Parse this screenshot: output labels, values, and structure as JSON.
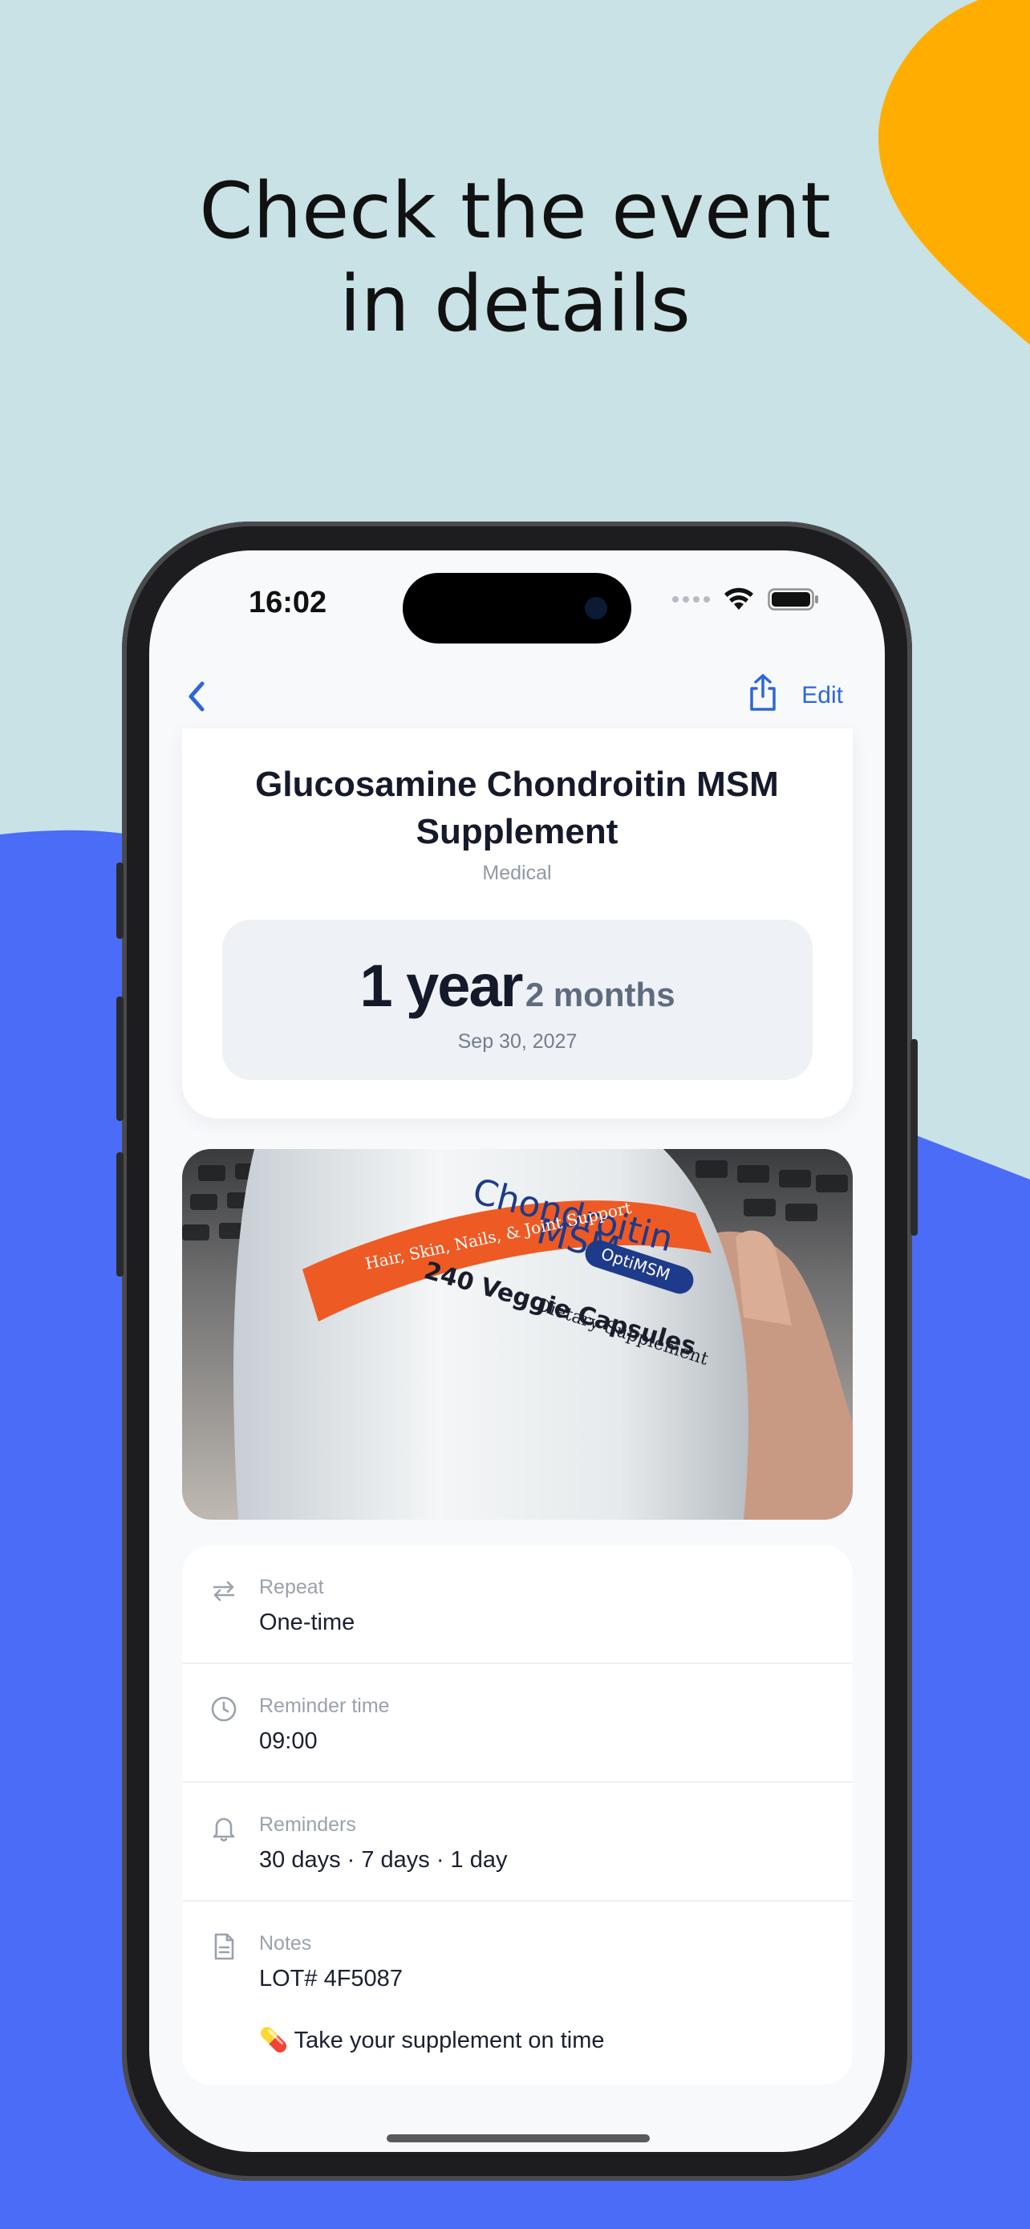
{
  "headline": {
    "line1": "Check the event",
    "line2": "in details"
  },
  "colors": {
    "background": "#c8e2e6",
    "blue_wave": "#4a6cf7",
    "orange_blob": "#ffae00",
    "accent": "#2e66d8"
  },
  "status_bar": {
    "time": "16:02"
  },
  "nav": {
    "back_icon": "chevron-left-icon",
    "share_icon": "share-icon",
    "edit_label": "Edit"
  },
  "event": {
    "title_line1": "Glucosamine Chondroitin MSM",
    "title_line2": "Supplement",
    "category": "Medical",
    "countdown_main": "1 year",
    "countdown_sub": "2 months",
    "date": "Sep 30, 2027"
  },
  "photo_text": {
    "line1": "Chondroitin",
    "line2": "MSM",
    "band": "Hair, Skin, Nails, & Joint Support",
    "badge": "OptiMSM",
    "capsules": "240 Veggie Capsules",
    "dietary": "Dietary Supplement"
  },
  "details": [
    {
      "icon": "repeat-icon",
      "label": "Repeat",
      "value": "One-time"
    },
    {
      "icon": "clock-icon",
      "label": "Reminder time",
      "value": "09:00"
    },
    {
      "icon": "bell-icon",
      "label": "Reminders",
      "value": "30 days · 7 days · 1 day"
    },
    {
      "icon": "document-icon",
      "label": "Notes",
      "value": "LOT# 4F5087",
      "extra": "💊 Take your supplement on time"
    }
  ]
}
